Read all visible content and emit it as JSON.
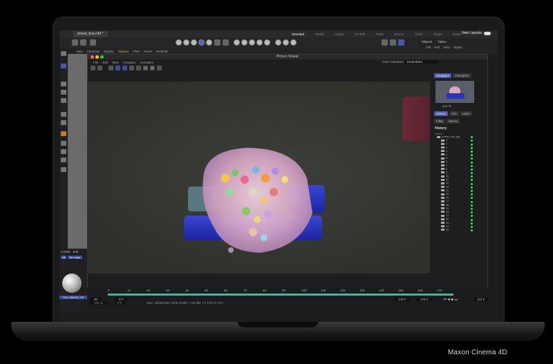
{
  "app": {
    "file_tab": "phase_bnp.c4d *",
    "layouts": [
      "Standard",
      "Model",
      "Sculpt",
      "UV Edit",
      "Paint",
      "Groom",
      "Track",
      "Script",
      "Nodes"
    ],
    "active_layout": "Standard",
    "new_layouts": "New Layouts"
  },
  "viewport_menu": [
    "View",
    "Cameras",
    "Display",
    "Options",
    "Filter",
    "Panel",
    "Redshift"
  ],
  "objects_panel": {
    "tabs": [
      "Objects",
      "Takes"
    ],
    "menu": [
      "File",
      "Edit",
      "View",
      "Object"
    ]
  },
  "picture_viewer": {
    "title": "Picture Viewer",
    "menu": [
      "File",
      "Edit",
      "View",
      "Compare",
      "Animation"
    ],
    "view_transform_label": "View Transform",
    "view_transform_value": "Embedded",
    "tool_letters": [
      "A",
      "B"
    ]
  },
  "right_panel": {
    "tabs_top": [
      "Navigator",
      "Histogram"
    ],
    "zoom": "141 %",
    "tabs_mid": [
      "History",
      "Info",
      "Layer"
    ],
    "tabs_mid2": [
      "Filter",
      "Stereo"
    ],
    "history_title": "History",
    "name_col": "Name",
    "root_item": "phase_bnp_jpg",
    "frames": [
      "0",
      "1",
      "2",
      "3",
      "4",
      "5",
      "6",
      "7",
      "8",
      "9",
      "10",
      "11",
      "12",
      "13",
      "14",
      "15",
      "16",
      "17",
      "18",
      "19",
      "20",
      "21",
      "22",
      "23",
      "24",
      "25"
    ]
  },
  "materials": {
    "tabs": [
      "Create",
      "Edit"
    ],
    "buttons": [
      "All",
      "No Layer"
    ],
    "material_name": "TEX_PACK2_VS"
  },
  "timeline": {
    "ruler": [
      "0",
      "10",
      "20",
      "30",
      "40",
      "50",
      "60",
      "70",
      "80",
      "90",
      "100",
      "110",
      "120",
      "130",
      "140",
      "150",
      "160",
      "170"
    ],
    "start_field": "30",
    "frame_field": "0 F",
    "frame_field2": "0 F",
    "end_field": "178 F",
    "end_field2": "178 F",
    "right_field": "172 F",
    "zoom": "141 %",
    "status": "Size: 1920x1080, RGB (8 Bit), 7.62 MB, ( F 178 of 178 )"
  },
  "caption": "Maxon Cinema 4D",
  "colors": {
    "accent_blue": "#4b5aa8",
    "timeline_teal": "#3fb7a5",
    "status_green": "#35e26a"
  }
}
